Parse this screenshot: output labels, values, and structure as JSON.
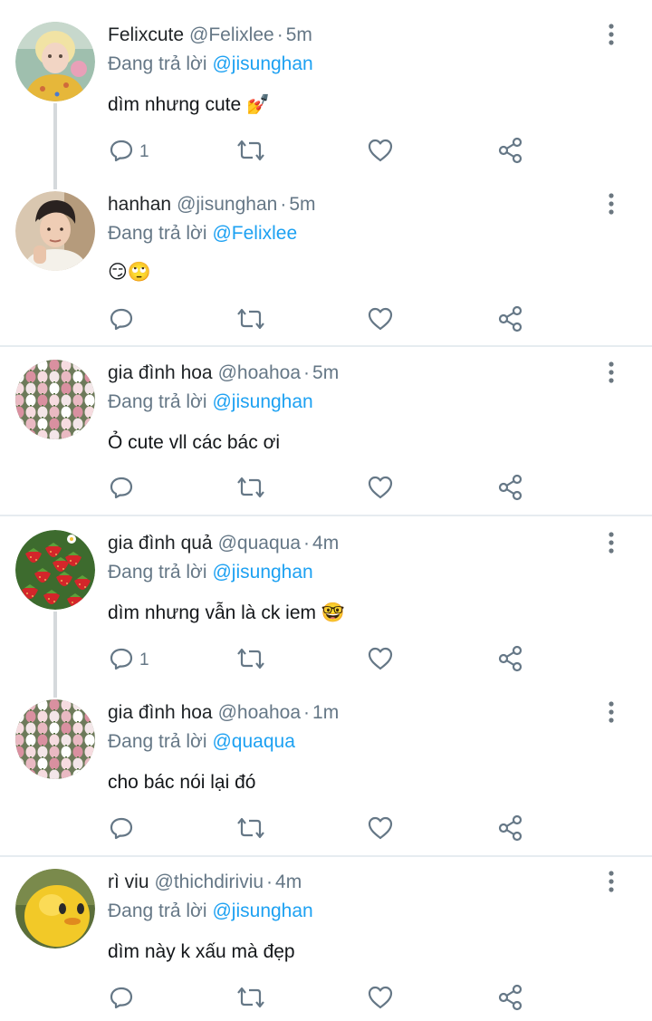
{
  "reply_prefix": "Đang trả lời",
  "colors": {
    "link": "#1da1f2",
    "muted": "#657786",
    "icon": "#657786",
    "thread": "#d5d9dc"
  },
  "posts": [
    {
      "name": "Felixcute",
      "handle": "@Felixlee",
      "time": "5m",
      "reply_to": "@jisunghan",
      "text": "dìm nhưng cute 💅",
      "reply_count": "1",
      "avatar": "felix-avatar"
    },
    {
      "name": "hanhan",
      "handle": "@jisunghan",
      "time": "5m",
      "reply_to": "@Felixlee",
      "text": "😏🙄",
      "reply_count": "",
      "avatar": "hanhan-avatar"
    },
    {
      "name": "gia đình hoa",
      "handle": "@hoahoa",
      "time": "5m",
      "reply_to": "@jisunghan",
      "text": "Ỏ cute vll các bác ơi",
      "reply_count": "",
      "avatar": "tulip-avatar"
    },
    {
      "name": "gia đình quả",
      "handle": "@quaqua",
      "time": "4m",
      "reply_to": "@jisunghan",
      "text": "dìm nhưng vẫn là ck iem 🤓",
      "reply_count": "1",
      "avatar": "strawberry-avatar"
    },
    {
      "name": "gia đình hoa",
      "handle": "@hoahoa",
      "time": "1m",
      "reply_to": "@quaqua",
      "text": "cho bác nói lại đó",
      "reply_count": "",
      "avatar": "tulip-avatar"
    },
    {
      "name": "rì viu",
      "handle": "@thichdiriviu",
      "time": "4m",
      "reply_to": "@jisunghan",
      "text": "dìm này k xấu mà đẹp",
      "reply_count": "",
      "avatar": "yellow-duck-avatar"
    }
  ]
}
